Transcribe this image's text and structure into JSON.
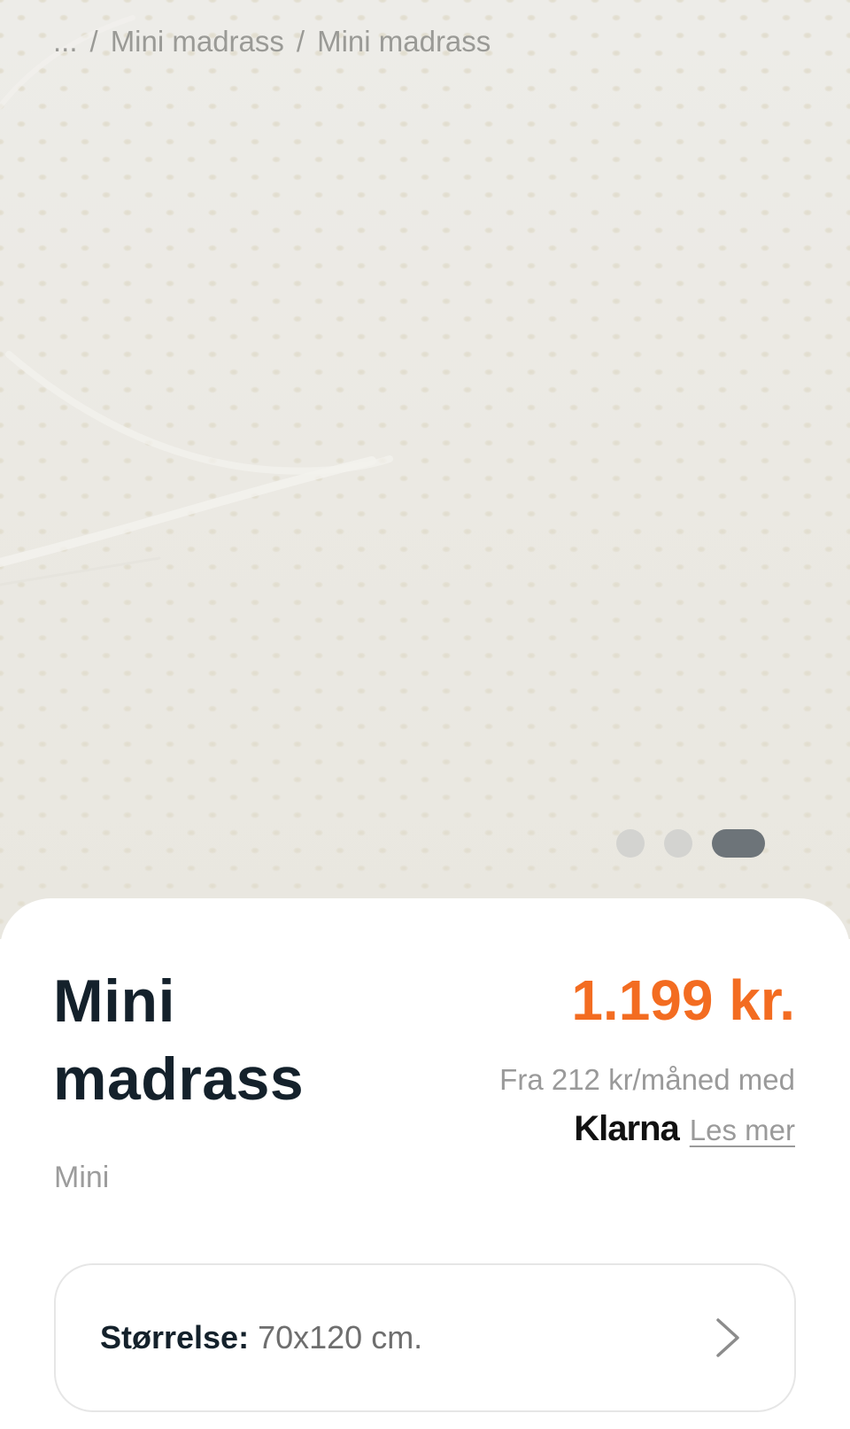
{
  "breadcrumb": {
    "ellipsis": "...",
    "separator": "/",
    "items": [
      "Mini madrass",
      "Mini madrass"
    ]
  },
  "carousel": {
    "slide_count": 3,
    "active_index": 2
  },
  "product": {
    "title": "Mini madrass",
    "variant": "Mini",
    "price": "1.199 kr.",
    "financing_text": "Fra 212 kr/måned med",
    "klarna_logo": "Klarna",
    "read_more": "Les mer"
  },
  "size_selector": {
    "label": "Størrelse:",
    "value": "70x120 cm.",
    "icon": "chevron-right-icon"
  },
  "colors": {
    "price": "#f36c21",
    "title": "#14212b",
    "muted": "#9a9a9a",
    "dot_active": "#6d7479",
    "dot_inactive": "#d3d3d0"
  }
}
